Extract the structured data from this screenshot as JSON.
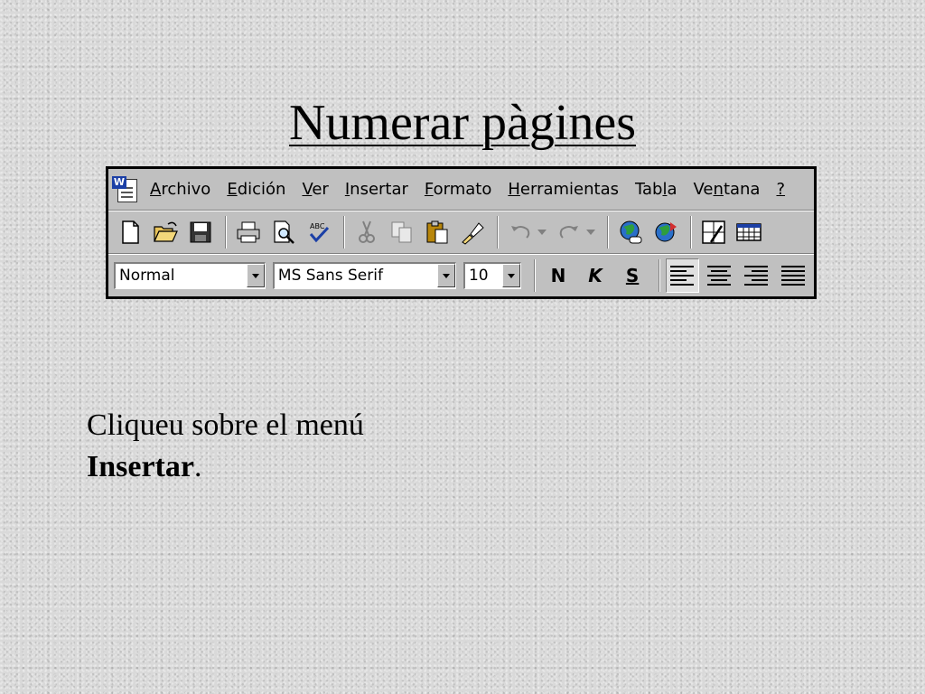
{
  "slide": {
    "title": "Numerar pàgines",
    "instruction_line1": "Cliqueu sobre el menú",
    "instruction_bold": "Insertar",
    "instruction_end": "."
  },
  "menubar": {
    "items": [
      {
        "label": "Archivo",
        "underline_index": 0
      },
      {
        "label": "Edición",
        "underline_index": 0
      },
      {
        "label": "Ver",
        "underline_index": 0
      },
      {
        "label": "Insertar",
        "underline_index": 0
      },
      {
        "label": "Formato",
        "underline_index": 0
      },
      {
        "label": "Herramientas",
        "underline_index": 0
      },
      {
        "label": "Tabla",
        "underline_index": 3
      },
      {
        "label": "Ventana",
        "underline_index": 2
      },
      {
        "label": "?",
        "underline_index": 0
      }
    ]
  },
  "format_toolbar": {
    "style_value": "Normal",
    "font_value": "MS Sans Serif",
    "size_value": "10",
    "bold_label": "N",
    "italic_label": "K",
    "underline_label": "S"
  },
  "colors": {
    "background": "#d9d9d9",
    "window_chrome": "#c0c0c0",
    "app_icon_blue": "#1b3fa6"
  },
  "icons": [
    "word-app-icon",
    "new-document-icon",
    "open-folder-icon",
    "save-icon",
    "print-icon",
    "print-preview-icon",
    "spelling-icon",
    "cut-icon",
    "copy-icon",
    "paste-icon",
    "format-painter-icon",
    "undo-icon",
    "redo-icon",
    "insert-hyperlink-icon",
    "web-toolbar-icon",
    "tables-borders-icon",
    "insert-table-icon",
    "align-left-icon",
    "center-icon",
    "align-right-icon",
    "justify-icon"
  ]
}
